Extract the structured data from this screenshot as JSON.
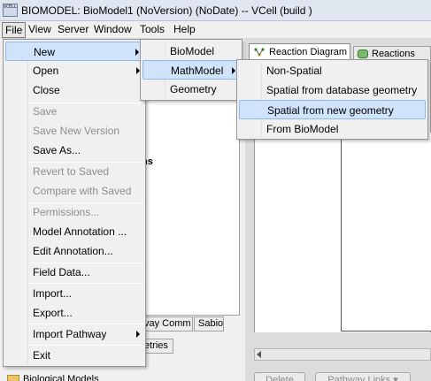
{
  "window": {
    "title": "BIOMODEL: BioModel1 (NoVersion) (NoDate) -- VCell  (build )",
    "icon_text": "VCELL"
  },
  "menubar": {
    "items": [
      "File",
      "View",
      "Server",
      "Window",
      "Tools",
      "Help"
    ]
  },
  "file_menu": {
    "items": [
      {
        "label": "New",
        "enabled": true,
        "submenu": true
      },
      {
        "label": "Open",
        "enabled": true,
        "submenu": true
      },
      {
        "label": "Close",
        "enabled": true
      },
      {
        "label": "Save",
        "enabled": false
      },
      {
        "label": "Save New Version",
        "enabled": false
      },
      {
        "label": "Save As...",
        "enabled": true
      },
      {
        "label": "Revert to Saved",
        "enabled": false
      },
      {
        "label": "Compare with Saved",
        "enabled": false
      },
      {
        "label": "Permissions...",
        "enabled": false
      },
      {
        "label": "Model Annotation ...",
        "enabled": true
      },
      {
        "label": "Edit Annotation...",
        "enabled": true
      },
      {
        "label": "Field Data...",
        "enabled": true
      },
      {
        "label": "Import...",
        "enabled": true
      },
      {
        "label": "Export...",
        "enabled": true
      },
      {
        "label": "Import Pathway",
        "enabled": true,
        "submenu": true
      },
      {
        "label": "Exit",
        "enabled": true
      }
    ]
  },
  "new_submenu": {
    "items": [
      "BioModel",
      "MathModel",
      "Geometry"
    ]
  },
  "mathmodel_submenu": {
    "items": [
      "Non-Spatial",
      "Spatial from database geometry",
      "Spatial from new geometry",
      "From BioModel"
    ],
    "highlighted": "Spatial from new geometry"
  },
  "background": {
    "right_tabs": [
      "Reaction Diagram",
      "Reactions"
    ],
    "left_fragment": "ns",
    "bottom_tabs": [
      "vay Comm",
      "Sabio",
      "etries"
    ],
    "tree_root": "Biological Models",
    "buttons": [
      "Delete",
      "Pathway Links ▾"
    ]
  },
  "colors": {
    "highlight": "#cfe3fa",
    "highlight_border": "#8fb7e8",
    "disabled_text": "#8d8d8d"
  }
}
